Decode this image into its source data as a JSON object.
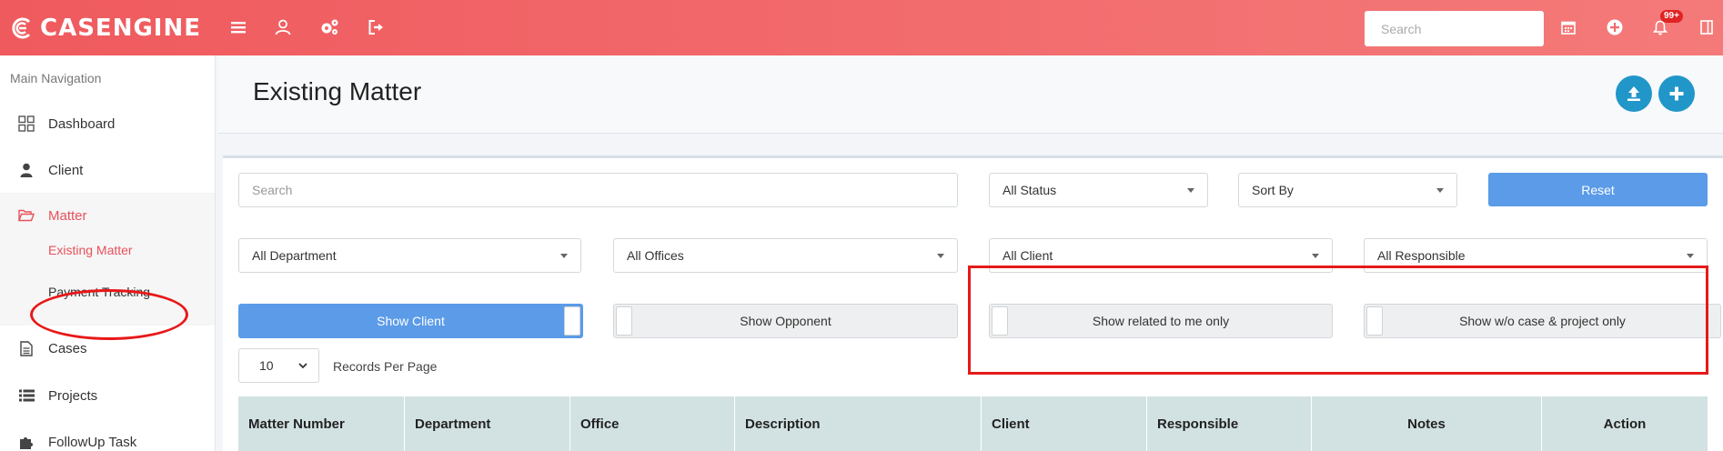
{
  "app": {
    "logo_text": "CASENGINE",
    "accent_color": "#ef5a5e",
    "primary_button_color": "#5b9be8"
  },
  "topbar": {
    "icons": [
      "menu-icon",
      "user-icon",
      "cogs-icon",
      "sign-out-icon"
    ],
    "search_placeholder": "Search",
    "right_icons": [
      "calendar-icon",
      "plus-circle-icon",
      "bell-icon",
      "sidebar-toggle-icon"
    ],
    "notification_count": "99+"
  },
  "sidebar": {
    "heading": "Main Navigation",
    "items": [
      {
        "label": "Dashboard",
        "icon": "dashboard-icon"
      },
      {
        "label": "Client",
        "icon": "user-icon"
      },
      {
        "label": "Matter",
        "icon": "folder-open-icon"
      },
      {
        "label": "Cases",
        "icon": "file-icon"
      },
      {
        "label": "Projects",
        "icon": "list-icon"
      },
      {
        "label": "FollowUp Task",
        "icon": "puzzle-icon"
      }
    ],
    "matter_sub": [
      {
        "label": "Existing Matter"
      },
      {
        "label": "Payment Tracking"
      }
    ]
  },
  "page": {
    "title": "Existing Matter"
  },
  "filters": {
    "search_placeholder": "Search",
    "status": "All Status",
    "sort": "Sort By",
    "reset_label": "Reset",
    "department": "All Department",
    "offices": "All Offices",
    "client": "All Client",
    "responsible": "All Responsible"
  },
  "toggles": {
    "show_client": "Show Client",
    "show_opponent": "Show Opponent",
    "show_related": "Show related to me only",
    "show_wo_case": "Show w/o case & project only"
  },
  "pagination": {
    "per_page_value": "10",
    "per_page_label": "Records Per Page"
  },
  "table": {
    "columns": [
      "Matter Number",
      "Department",
      "Office",
      "Description",
      "Client",
      "Responsible",
      "Notes",
      "Action"
    ]
  }
}
